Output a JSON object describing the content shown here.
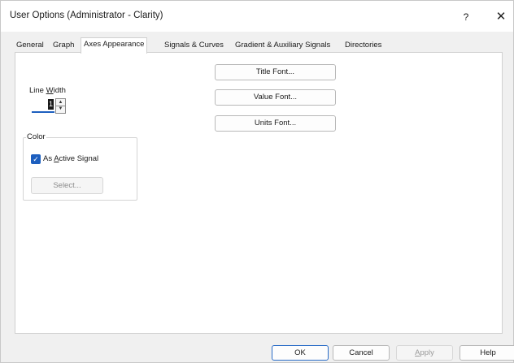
{
  "window": {
    "title": "User Options (Administrator - Clarity)",
    "help_glyph": "?",
    "close_glyph": "✕"
  },
  "tabs": [
    {
      "label": "General",
      "active": false
    },
    {
      "label": "Graph",
      "active": false
    },
    {
      "label": "Axes Appearance",
      "active": true
    },
    {
      "label": "Signals & Curves",
      "active": false
    },
    {
      "label": "Gradient & Auxiliary Signals",
      "active": false
    },
    {
      "label": "Directories",
      "active": false
    }
  ],
  "line_width": {
    "label_pre": "Line ",
    "label_accel": "W",
    "label_post": "idth",
    "value": "1"
  },
  "color_group": {
    "legend": "Color",
    "checkbox_checked": true,
    "checkbox_label_pre": "As ",
    "checkbox_label_accel": "A",
    "checkbox_label_post": "ctive Signal",
    "select_button": "Select..."
  },
  "font_buttons": {
    "title_font": "Title Font...",
    "value_font": "Value Font...",
    "units_font": "Units Font..."
  },
  "footer": {
    "ok": "OK",
    "cancel": "Cancel",
    "apply_accel": "A",
    "apply_post": "pply",
    "help": "Help"
  },
  "colors": {
    "accent": "#1d5fbf",
    "panel_bg": "#ffffff",
    "dialog_bg": "#f0f0f0"
  }
}
